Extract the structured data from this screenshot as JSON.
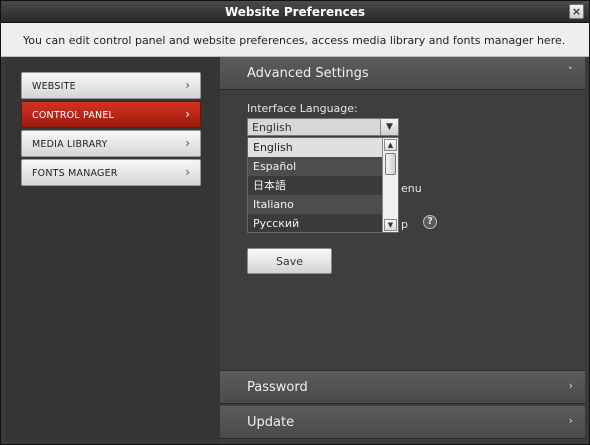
{
  "window": {
    "title": "Website Preferences",
    "close_glyph": "×"
  },
  "info": {
    "text": "You can edit control panel and website preferences, access media library and fonts manager here."
  },
  "sidebar": {
    "items": [
      {
        "label": "WEBSITE",
        "active": false
      },
      {
        "label": "CONTROL PANEL",
        "active": true
      },
      {
        "label": "MEDIA LIBRARY",
        "active": false
      },
      {
        "label": "FONTS MANAGER",
        "active": false
      }
    ],
    "chevron": "›"
  },
  "sections": {
    "advanced": {
      "label": "Advanced Settings",
      "chevron": "˅"
    },
    "password": {
      "label": "Password",
      "chevron": "›"
    },
    "update": {
      "label": "Update",
      "chevron": "›"
    }
  },
  "language": {
    "label": "Interface Language:",
    "selected": "English",
    "options": [
      "English",
      "Español",
      "日本語",
      "Italiano",
      "Русский"
    ]
  },
  "hidden_rows": {
    "menu_suffix": "enu",
    "p_suffix": "p"
  },
  "save_button": {
    "label": "Save"
  },
  "help": {
    "glyph": "?"
  },
  "colors": {
    "accent": "#c0281a",
    "panel": "#3e3e3e"
  }
}
